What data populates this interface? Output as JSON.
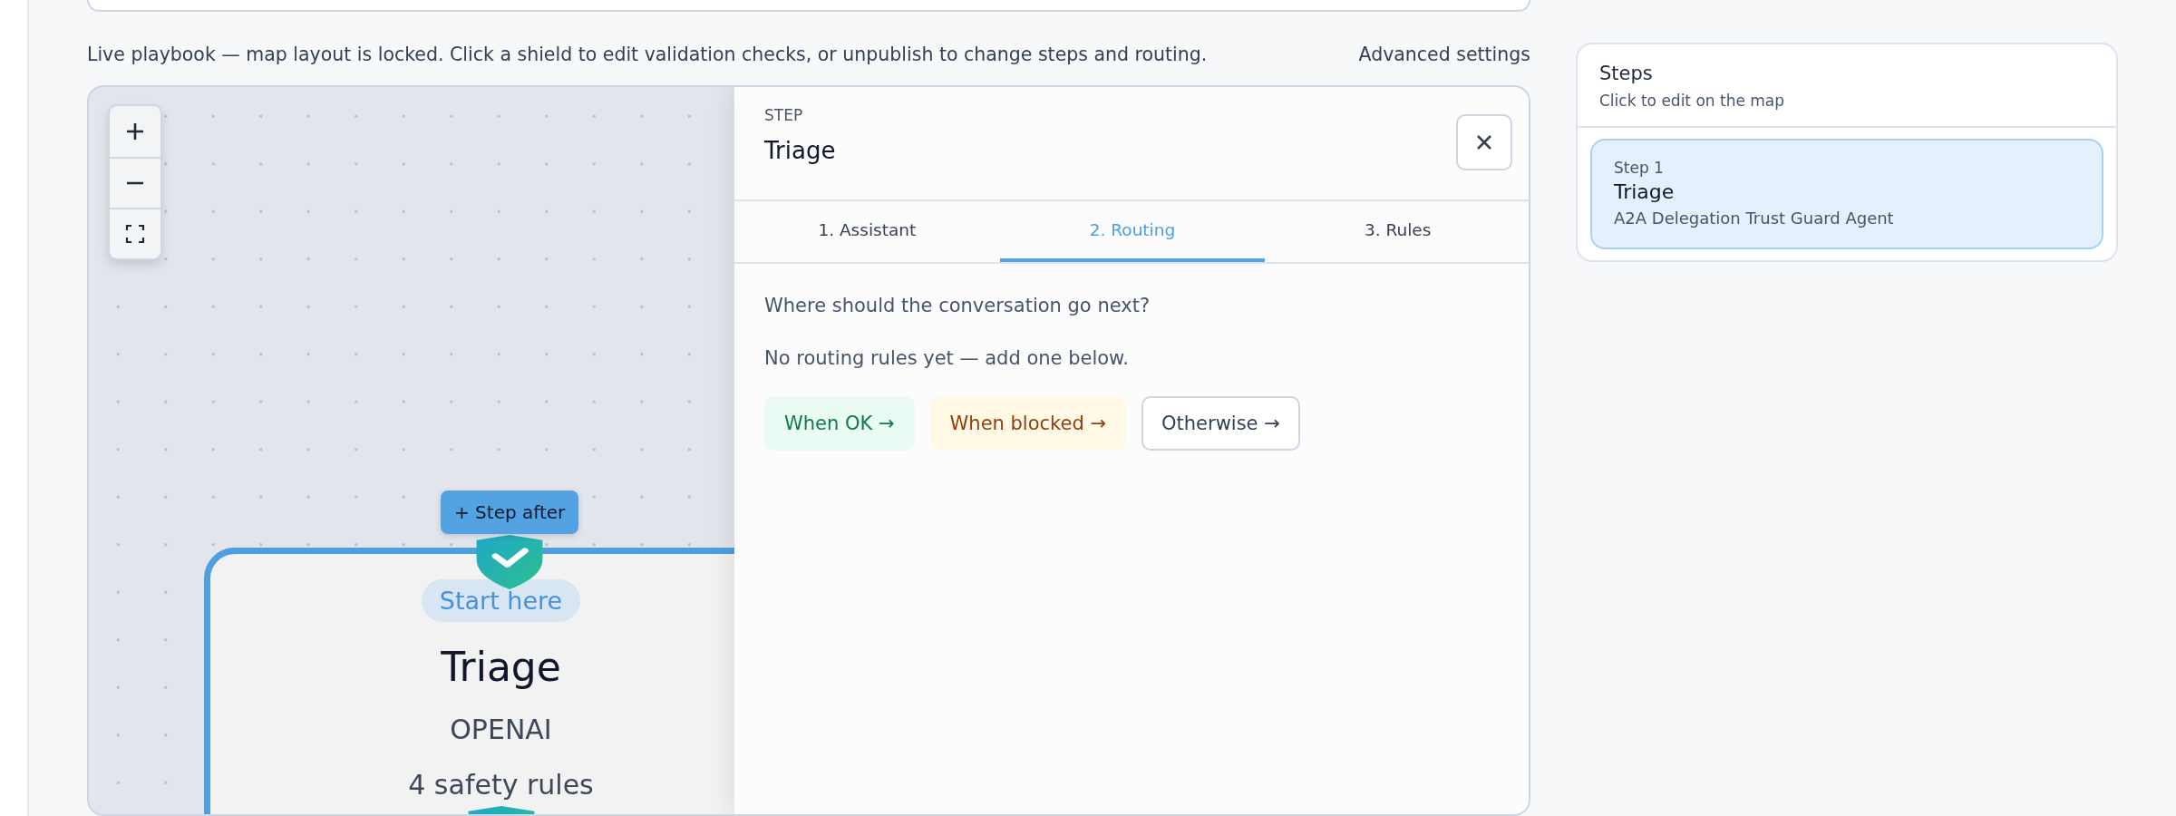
{
  "notice": "Live playbook — map layout is locked. Click a shield to edit validation checks, or unpublish to change steps and routing.",
  "advanced_link": "Advanced settings",
  "map": {
    "add_step_button": "+ Step after",
    "node": {
      "badge": "Start here",
      "title": "Triage",
      "provider": "OPENAI",
      "rules": "4 safety rules",
      "selected": true
    }
  },
  "panel": {
    "eyebrow": "STEP",
    "title": "Triage",
    "tabs": [
      {
        "label": "1. Assistant",
        "selected": false
      },
      {
        "label": "2. Routing",
        "selected": true
      },
      {
        "label": "3. Rules",
        "selected": false
      }
    ],
    "question": "Where should the conversation go next?",
    "empty_note": "No routing rules yet — add one below.",
    "route_buttons": [
      {
        "label": "When OK →",
        "kind": "ok"
      },
      {
        "label": "When blocked →",
        "kind": "blocked"
      },
      {
        "label": "Otherwise →",
        "kind": "otherwise"
      }
    ]
  },
  "steps": {
    "title": "Steps",
    "subtitle": "Click to edit on the map",
    "items": [
      {
        "number": "Step 1",
        "title": "Triage",
        "agent": "A2A Delegation Trust Guard Agent",
        "selected": true
      }
    ]
  }
}
